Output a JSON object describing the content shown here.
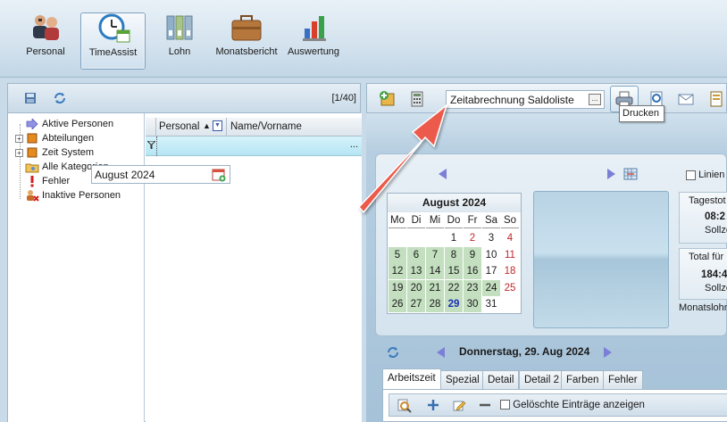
{
  "toolbar": {
    "buttons": [
      {
        "label": "Personal",
        "icon": "people-icon"
      },
      {
        "label": "TimeAssist",
        "icon": "clock-calendar-icon"
      },
      {
        "label": "Lohn",
        "icon": "binders-icon"
      },
      {
        "label": "Monatsbericht",
        "icon": "briefcase-icon"
      },
      {
        "label": "Auswertung",
        "icon": "bar-chart-icon"
      }
    ],
    "active": "TimeAssist"
  },
  "left_panel": {
    "record_count": "[1/40]",
    "tree": [
      {
        "label": "Aktive Personen",
        "icon": "arrow-right-icon",
        "expandable": false
      },
      {
        "label": "Abteilungen",
        "icon": "orange-square-icon",
        "expandable": true
      },
      {
        "label": "Zeit System",
        "icon": "orange-square-icon",
        "expandable": true
      },
      {
        "label": "Alle Kategorien",
        "icon": "folder-key-icon",
        "expandable": false
      },
      {
        "label": "Fehler",
        "icon": "exclamation-icon",
        "expandable": false
      },
      {
        "label": "Inaktive Personen",
        "icon": "person-x-icon",
        "expandable": false
      }
    ],
    "grid": {
      "columns": [
        "Personal",
        "Name/Vorname"
      ],
      "filter_ellipsis": "..."
    }
  },
  "right_panel": {
    "report_select": {
      "value": "Zeitabrechnung Saldoliste",
      "button": "..."
    },
    "tooltip": "Drucken",
    "month_value": "August 2024",
    "lines_label": "Linien",
    "calendar": {
      "title": "August 2024",
      "weekdays": [
        "Mo",
        "Di",
        "Mi",
        "Do",
        "Fr",
        "Sa",
        "So"
      ],
      "days": [
        [
          "",
          "",
          "",
          "1",
          "2",
          "3",
          "4"
        ],
        [
          "5",
          "6",
          "7",
          "8",
          "9",
          "10",
          "11"
        ],
        [
          "12",
          "13",
          "14",
          "15",
          "16",
          "17",
          "18"
        ],
        [
          "19",
          "20",
          "21",
          "22",
          "23",
          "24",
          "25"
        ],
        [
          "26",
          "27",
          "28",
          "29",
          "30",
          "31",
          ""
        ]
      ],
      "today": "29"
    },
    "day_summary": {
      "title": "Tagestot",
      "value": "08:2",
      "sub": "Sollze"
    },
    "total_summary": {
      "title": "Total für",
      "value": "184:4",
      "sub": "Sollze"
    },
    "monthly_label": "Monatslohn",
    "current_day": "Donnerstag, 29. Aug 2024",
    "tabs": [
      "Arbeitszeit",
      "Spezial",
      "Detail",
      "Detail 2",
      "Farben",
      "Fehler"
    ],
    "active_tab": "Arbeitszeit",
    "show_deleted_label": "Gelöschte Einträge anzeigen"
  },
  "colors": {
    "accent": "#2a6db0",
    "calendar_green": "#c4dfc0",
    "weekend_red": "#c0272d",
    "annotation_arrow": "#ec5a4c"
  }
}
